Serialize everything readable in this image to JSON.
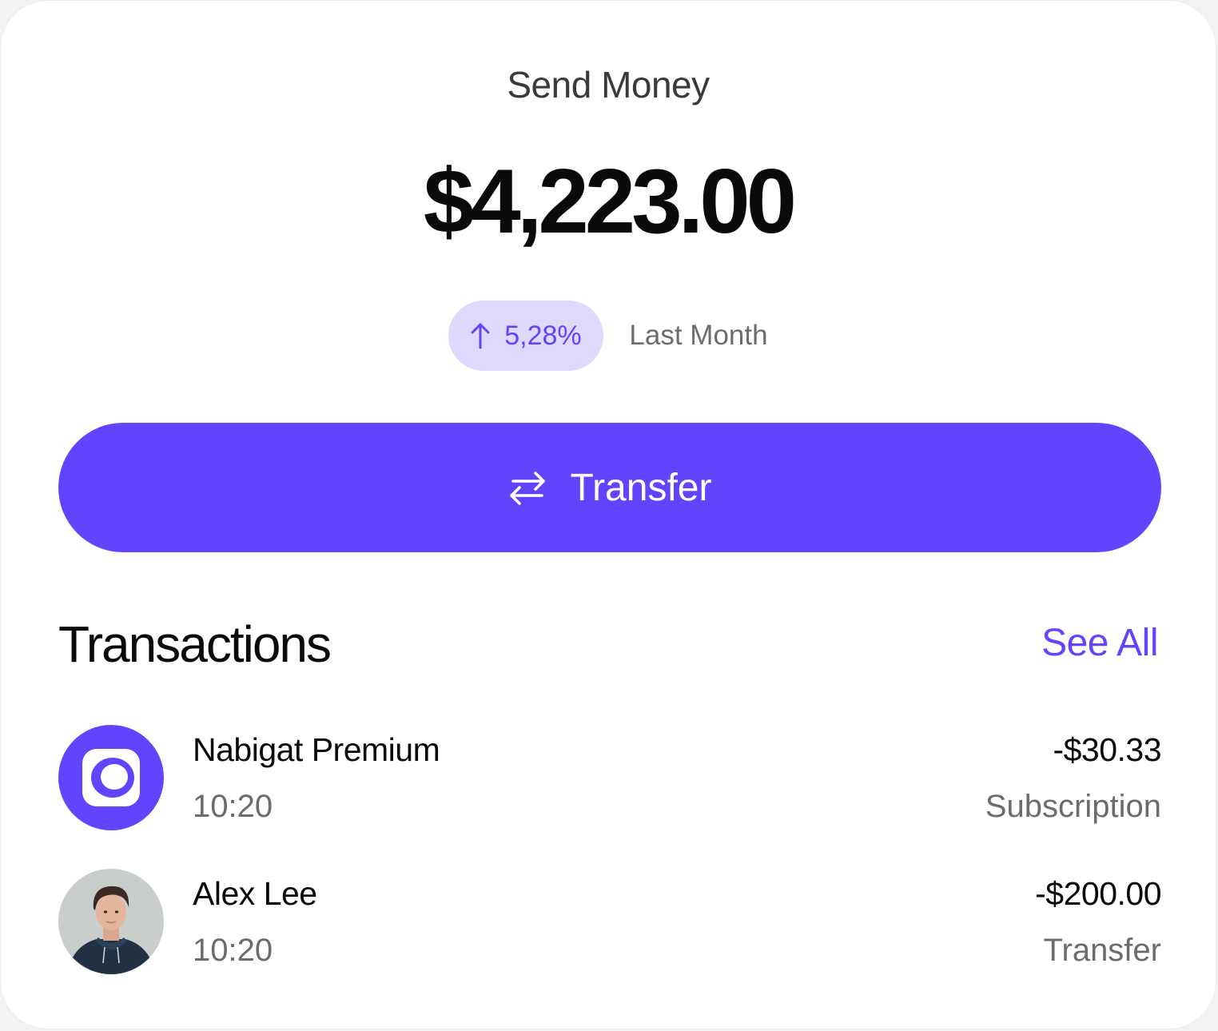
{
  "header": {
    "title": "Send Money",
    "balance": "$4,223.00"
  },
  "change": {
    "direction_icon": "arrow-up-icon",
    "value": "5,28%",
    "period": "Last Month"
  },
  "transfer_button": {
    "icon": "swap-arrows-icon",
    "label": "Transfer"
  },
  "transactions": {
    "title": "Transactions",
    "see_all": "See All",
    "items": [
      {
        "avatar": "nabigat-logo-icon",
        "name": "Nabigat Premium",
        "time": "10:20",
        "amount": "-$30.33",
        "category": "Subscription"
      },
      {
        "avatar": "alex-lee-photo",
        "name": "Alex Lee",
        "time": "10:20",
        "amount": "-$200.00",
        "category": "Transfer"
      }
    ]
  },
  "colors": {
    "accent": "#6244ff",
    "accent_light": "#dedafe",
    "text_primary": "#0a0a0a",
    "text_secondary": "#6b6b70"
  }
}
